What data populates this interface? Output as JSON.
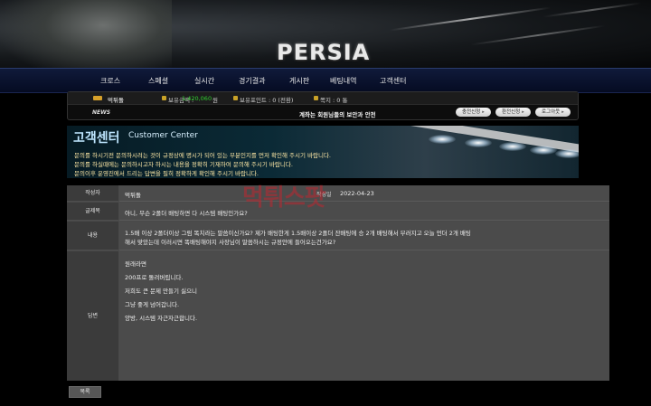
{
  "site": {
    "logo": "PERSIA"
  },
  "nav": {
    "items": [
      "크로스",
      "스페셜",
      "실시간",
      "경기결과",
      "게시판",
      "베팅내역",
      "고객센터"
    ]
  },
  "account": {
    "username": "먹튀돌",
    "balance_label": "보유금액 :",
    "balance_value": "1,420,060",
    "balance_unit": "원",
    "points_label": "보유포인트 : 0 (전환)",
    "notes_label": "쪽지 : 0 통",
    "news_label": "NEWS",
    "notice": "계좌는 회원님들의 보안과 안전",
    "buttons": [
      "충전신청",
      "환전신청",
      "로그아웃"
    ]
  },
  "banner": {
    "title_ko": "고객센터",
    "title_en": "Customer Center",
    "lines": [
      "문의를 하시기전 문의하시려는 것이 규정상에 명시가 되어 있는 부분인지를 먼저 확인해 주시기 바랍니다.",
      "문의를 하실때에는 문의하시고자 하시는 내용을 정확히 기재하여 문의해 주시기 바랍니다.",
      "문의이후 운영진에서 드리는 답변을 필히 정확하게 확인해 주시기 바랍니다."
    ]
  },
  "post": {
    "author_label": "작성자",
    "author_value": "먹튀돌",
    "date_label": "작성일",
    "date_value": "2022-04-23",
    "title_label": "글제목",
    "title_value": "아니, 무슨 2폴더 배팅하면 다 시스템 배팅인가요?",
    "content_label": "내용",
    "content_lines": [
      "1.5배 이상 2폴더이상 그럼 똑치라는 말씀이신가요? 제가 배팅한게 1.5배이상 2폴더 잔배팅에 승 2개 배팅해서 부러지고 오늘 언더 2개 배팅",
      "해서 맞았는데 이러시면 똑배팅해야지 사장님이 말씀하시는 규정안에 들어오는건가요?"
    ],
    "answer_label": "답변",
    "answer_lines": [
      "원래라면",
      "200프로 돌려버립니다.",
      "저희도 큰 문제 만들기 싫으니",
      "그냥 좋게 넘어갑니다.",
      "양방, 시스템 자근자근합니다."
    ]
  },
  "watermark": "먹튀스팟",
  "footer": {
    "list_button": "목록"
  }
}
